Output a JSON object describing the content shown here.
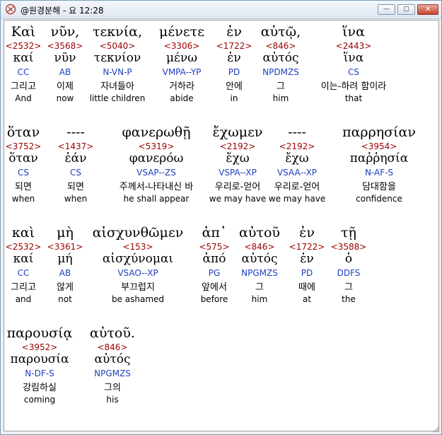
{
  "window": {
    "title": "@원경분해 - 요 12:28",
    "title_icon": "app-logo-icon",
    "controls": {
      "minimize": "—",
      "maximize": "▢",
      "close": "✕"
    }
  },
  "rows": [
    {
      "words": [
        {
          "greek": "Καὶ",
          "strong": "<2532>",
          "lemma": "καί",
          "morph": "CC",
          "korean": "그리고",
          "english": "And"
        },
        {
          "greek": "νῦν,",
          "strong": "<3568>",
          "lemma": "νῦν",
          "morph": "AB",
          "korean": "이제",
          "english": "now"
        },
        {
          "greek": "τεκνία,",
          "strong": "<5040>",
          "lemma": "τεκνίον",
          "morph": "N-VN-P",
          "korean": "자녀들아",
          "english": "little children"
        },
        {
          "greek": "μένετε",
          "strong": "<3306>",
          "lemma": "μένω",
          "morph": "VMPA--YP",
          "korean": "거하라",
          "english": "abide"
        },
        {
          "greek": "ἐν",
          "strong": "<1722>",
          "lemma": "ἐν",
          "morph": "PD",
          "korean": "안에",
          "english": "in"
        },
        {
          "greek": "αὐτῷ,",
          "strong": "<846>",
          "lemma": "αὐτός",
          "morph": "NPDMZS",
          "korean": "그",
          "english": "him"
        },
        {
          "greek": "ἵνα",
          "strong": "<2443>",
          "lemma": "ἵνα",
          "morph": "CS",
          "korean": "이는-하려 함이라",
          "english": "that"
        }
      ]
    },
    {
      "words": [
        {
          "greek": "ὅταν",
          "strong": "<3752>",
          "lemma": "ὅταν",
          "morph": "CS",
          "korean": "되면",
          "english": "when"
        },
        {
          "greek": "----",
          "strong": "<1437>",
          "lemma": "ἐάν",
          "morph": "CS",
          "korean": "되면",
          "english": "when"
        },
        {
          "greek": "φανερωθῇ",
          "strong": "<5319>",
          "lemma": "φανερόω",
          "morph": "VSAP--ZS",
          "korean": "주께서-나타내신 바",
          "english": "he shall appear"
        },
        {
          "greek": "ἔχωμεν",
          "strong": "<2192>",
          "lemma": "ἔχω",
          "morph": "VSPA--XP",
          "korean": "우리로-얻어",
          "english": "we may have"
        },
        {
          "greek": "----",
          "strong": "<2192>",
          "lemma": "ἔχω",
          "morph": "VSAA--XP",
          "korean": "우리로-얻어",
          "english": "we may have"
        },
        {
          "greek": "παρρησίαν",
          "strong": "<3954>",
          "lemma": "παῤῥησία",
          "morph": "N-AF-S",
          "korean": "담대함을",
          "english": "confidence"
        }
      ]
    },
    {
      "words": [
        {
          "greek": "καὶ",
          "strong": "<2532>",
          "lemma": "καί",
          "morph": "CC",
          "korean": "그리고",
          "english": "and"
        },
        {
          "greek": "μὴ",
          "strong": "<3361>",
          "lemma": "μή",
          "morph": "AB",
          "korean": "않게",
          "english": "not"
        },
        {
          "greek": "αἰσχυνθῶμεν",
          "strong": "<153>",
          "lemma": "αἰσχύνομαι",
          "morph": "VSAO--XP",
          "korean": "부끄럽지",
          "english": "be ashamed"
        },
        {
          "greek": "ἀπ᾽",
          "strong": "<575>",
          "lemma": "ἀπό",
          "morph": "PG",
          "korean": "앞에서",
          "english": "before"
        },
        {
          "greek": "αὐτοῦ",
          "strong": "<846>",
          "lemma": "αὐτός",
          "morph": "NPGMZS",
          "korean": "그",
          "english": "him"
        },
        {
          "greek": "ἐν",
          "strong": "<1722>",
          "lemma": "ἐν",
          "morph": "PD",
          "korean": "때에",
          "english": "at"
        },
        {
          "greek": "τῇ",
          "strong": "<3588>",
          "lemma": "ὁ",
          "morph": "DDFS",
          "korean": "그",
          "english": "the"
        }
      ]
    },
    {
      "words": [
        {
          "greek": "παρουσίᾳ",
          "strong": "<3952>",
          "lemma": "παρουσία",
          "morph": "N-DF-S",
          "korean": "강림하실",
          "english": "coming"
        },
        {
          "greek": "αὐτοῦ.",
          "strong": "<846>",
          "lemma": "αὐτός",
          "morph": "NPGMZS",
          "korean": "그의",
          "english": "his"
        }
      ]
    }
  ],
  "colors": {
    "strong": "#990000",
    "morph": "#1f3fbf",
    "text": "#000000",
    "background": "#ffffff",
    "highlight": "#ffffff"
  }
}
